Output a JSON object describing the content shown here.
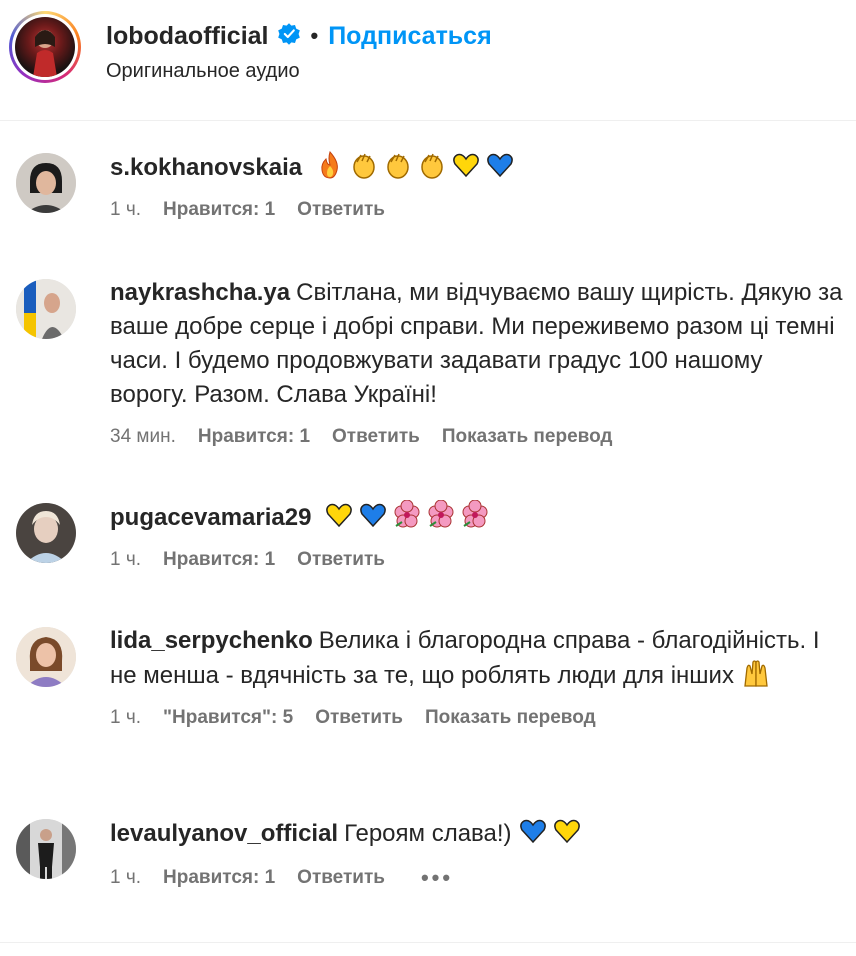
{
  "post": {
    "owner": "lobodaofficial",
    "subscribe_label": "Подписаться",
    "audio_label": "Оригинальное аудио",
    "separator": "•"
  },
  "colors": {
    "accent": "#0095f6",
    "text": "#262626",
    "meta": "#737373"
  },
  "comments": [
    {
      "user": "s.kokhanovskaia",
      "text": "",
      "emojis": [
        "fire-emoji",
        "clap-emoji",
        "clap-emoji",
        "clap-emoji",
        "yellow-heart-emoji",
        "blue-heart-emoji"
      ],
      "time": "1 ч.",
      "likes": "Нравится: 1",
      "reply": "Ответить"
    },
    {
      "user": "naykrashcha.ya",
      "text": "Світлана, ми відчуваємо вашу щирість. Дякую за ваше добре серце і добрі справи. Ми переживемо разом ці темні часи. І будемо продовжувати задавати градус 100 нашому ворогу. Разом. Слава Україні!",
      "time": "34 мин.",
      "likes": "Нравится: 1",
      "reply": "Ответить",
      "translate": "Показать перевод"
    },
    {
      "user": "pugacevamaria29",
      "text": "",
      "emojis": [
        "yellow-heart-emoji",
        "blue-heart-emoji",
        "hibiscus-emoji",
        "hibiscus-emoji",
        "hibiscus-emoji"
      ],
      "time": "1 ч.",
      "likes": "Нравится: 1",
      "reply": "Ответить"
    },
    {
      "user": "lida_serpychenko",
      "text": "Велика і благородна справа - благодійність. І не менша - вдячність за те, що роблять люди для інших",
      "emojis": [
        "raised-hands-emoji"
      ],
      "time": "1 ч.",
      "likes": "\"Нравится\": 5",
      "reply": "Ответить",
      "translate": "Показать перевод"
    },
    {
      "user": "levaulyanov_official",
      "text": "Героям слава!)",
      "emojis": [
        "blue-heart-emoji",
        "yellow-heart-emoji"
      ],
      "time": "1 ч.",
      "likes": "Нравится: 1",
      "reply": "Ответить",
      "more": "•••"
    }
  ]
}
